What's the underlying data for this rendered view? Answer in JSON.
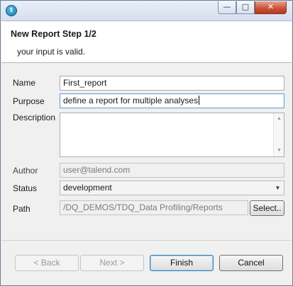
{
  "window": {
    "app_icon_glyph": "t",
    "controls": {
      "minimize": "—",
      "maximize": "□",
      "close": "✕"
    }
  },
  "header": {
    "title": "New Report Step 1/2",
    "message": "your input is valid."
  },
  "form": {
    "name": {
      "label": "Name",
      "value": "First_report"
    },
    "purpose": {
      "label": "Purpose",
      "value": "define a report for multiple analyses"
    },
    "description": {
      "label": "Description",
      "value": ""
    },
    "author": {
      "label": "Author",
      "value": "user@talend.com"
    },
    "status": {
      "label": "Status",
      "value": "development"
    },
    "path": {
      "label": "Path",
      "value": "/DQ_DEMOS/TDQ_Data Profiling/Reports",
      "select_label": "Select.."
    }
  },
  "buttons": {
    "back": "< Back",
    "next": "Next >",
    "finish": "Finish",
    "cancel": "Cancel"
  },
  "icons": {
    "app": "talend-icon",
    "scroll_up": "▲",
    "scroll_down": "▼",
    "dropdown": "▼"
  }
}
